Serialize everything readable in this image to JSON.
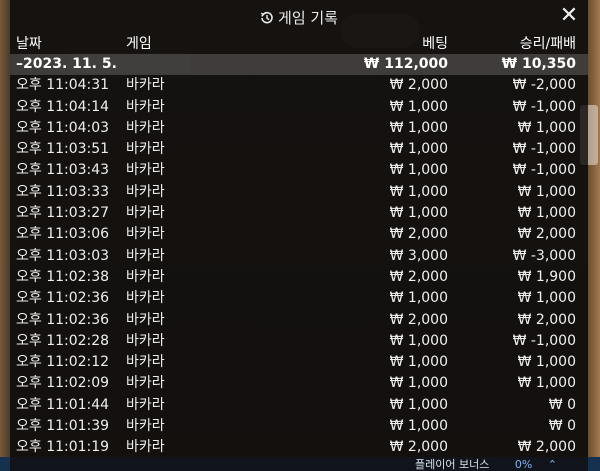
{
  "window": {
    "title": "게임 기록",
    "title_icon": "history-icon",
    "close_icon": "close-icon"
  },
  "columns": {
    "date": "날짜",
    "game": "게임",
    "bet": "베팅",
    "win": "승리/패배"
  },
  "summary": {
    "date": "–2023. 11. 5.",
    "game": "",
    "bet": "₩ 112,000",
    "win": "₩ 10,350"
  },
  "rows": [
    {
      "time": "오후 11:04:31",
      "game": "바카라",
      "bet": "₩ 2,000",
      "win": "₩ -2,000"
    },
    {
      "time": "오후 11:04:14",
      "game": "바카라",
      "bet": "₩ 1,000",
      "win": "₩ -1,000"
    },
    {
      "time": "오후 11:04:03",
      "game": "바카라",
      "bet": "₩ 1,000",
      "win": "₩ 1,000"
    },
    {
      "time": "오후 11:03:51",
      "game": "바카라",
      "bet": "₩ 1,000",
      "win": "₩ -1,000"
    },
    {
      "time": "오후 11:03:43",
      "game": "바카라",
      "bet": "₩ 1,000",
      "win": "₩ -1,000"
    },
    {
      "time": "오후 11:03:33",
      "game": "바카라",
      "bet": "₩ 1,000",
      "win": "₩ 1,000"
    },
    {
      "time": "오후 11:03:27",
      "game": "바카라",
      "bet": "₩ 1,000",
      "win": "₩ 1,000"
    },
    {
      "time": "오후 11:03:06",
      "game": "바카라",
      "bet": "₩ 2,000",
      "win": "₩ 2,000"
    },
    {
      "time": "오후 11:03:03",
      "game": "바카라",
      "bet": "₩ 3,000",
      "win": "₩ -3,000"
    },
    {
      "time": "오후 11:02:38",
      "game": "바카라",
      "bet": "₩ 2,000",
      "win": "₩ 1,900"
    },
    {
      "time": "오후 11:02:36",
      "game": "바카라",
      "bet": "₩ 1,000",
      "win": "₩ 1,000"
    },
    {
      "time": "오후 11:02:36",
      "game": "바카라",
      "bet": "₩ 2,000",
      "win": "₩ 2,000"
    },
    {
      "time": "오후 11:02:28",
      "game": "바카라",
      "bet": "₩ 1,000",
      "win": "₩ -1,000"
    },
    {
      "time": "오후 11:02:12",
      "game": "바카라",
      "bet": "₩ 1,000",
      "win": "₩ 1,000"
    },
    {
      "time": "오후 11:02:09",
      "game": "바카라",
      "bet": "₩ 1,000",
      "win": "₩ 1,000"
    },
    {
      "time": "오후 11:01:44",
      "game": "바카라",
      "bet": "₩ 1,000",
      "win": "₩ 0"
    },
    {
      "time": "오후 11:01:39",
      "game": "바카라",
      "bet": "₩ 1,000",
      "win": "₩ 0"
    },
    {
      "time": "오후 11:01:19",
      "game": "바카라",
      "bet": "₩ 2,000",
      "win": "₩ 2,000"
    }
  ],
  "footer": {
    "bonus_label": "플레이어 보너스",
    "bonus_pct": "0%"
  }
}
